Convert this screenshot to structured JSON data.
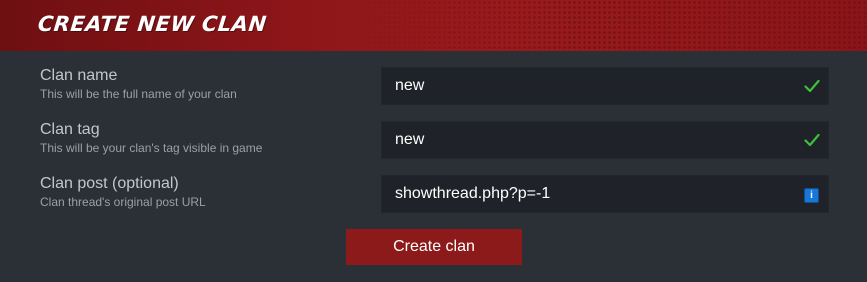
{
  "header": {
    "title": "CREATE NEW CLAN",
    "accent_color": "#8e1619"
  },
  "form": {
    "fields": [
      {
        "label": "Clan name",
        "description": "This will be the full name of your clan",
        "value": "new",
        "status_icon": "check-icon",
        "status_color": "#3fbf3f"
      },
      {
        "label": "Clan tag",
        "description": "This will be your clan's tag visible in game",
        "value": "new",
        "status_icon": "check-icon",
        "status_color": "#3fbf3f"
      },
      {
        "label": "Clan post (optional)",
        "description": "Clan thread's original post URL",
        "value": "showthread.php?p=-1",
        "status_icon": "info-icon",
        "status_glyph": "i",
        "status_color": "#1877d6"
      }
    ],
    "submit_label": "Create clan",
    "submit_color": "#8c1a1a"
  }
}
